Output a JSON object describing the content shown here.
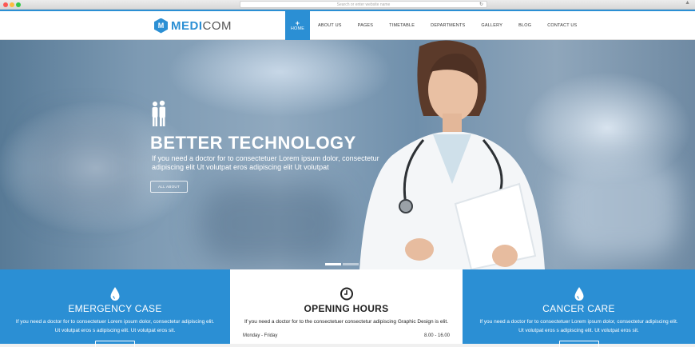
{
  "browser": {
    "url_placeholder": "Search or enter website name",
    "traffic_colors": [
      "#fc5753",
      "#fdbc40",
      "#33c748"
    ]
  },
  "brand": {
    "logo_letter": "M",
    "name_bold": "MEDI",
    "name_light": "COM",
    "accent_color": "#2b8fd4"
  },
  "nav": {
    "items": [
      {
        "label": "HOME",
        "active": true
      },
      {
        "label": "ABOUT US"
      },
      {
        "label": "PAGES"
      },
      {
        "label": "TIMETABLE"
      },
      {
        "label": "DEPARTMENTS"
      },
      {
        "label": "GALLERY"
      },
      {
        "label": "BLOG"
      },
      {
        "label": "CONTACT US"
      }
    ],
    "active_icon": "plus-icon"
  },
  "hero": {
    "icon": "family-icon",
    "title": "BETTER TECHNOLOGY",
    "text": "If you need a doctor for to consectetuer Lorem ipsum dolor, consectetur adipiscing elit  Ut volutpat eros adipiscing elit Ut volutpat",
    "button_label": "ALL ABOUT",
    "slide_count": 2,
    "active_slide": 1
  },
  "panels": [
    {
      "icon": "drop-icon",
      "title": "EMERGENCY CASE",
      "text_line1": "If you need a doctor for to consectetuer Lorem ipsum dolor, consectetur adipiscing elit.",
      "text_line2": "Ut volutpat eros s adipiscing elit. Ut volutpat eros sit."
    },
    {
      "icon": "clock-icon",
      "title": "OPENING HOURS",
      "text_line1": "If you need a doctor for to the consectetuer consectetur adipiscing Graphic Design is elit.",
      "hours": [
        {
          "days": "Monday - Friday",
          "time": "8.00 - 16.00"
        }
      ]
    },
    {
      "icon": "drop-icon",
      "title": "CANCER CARE",
      "text_line1": "If you need a doctor for to consectetuer Lorem ipsum dolor, consectetur adipiscing elit.",
      "text_line2": "Ut volutpat eros s adipiscing elit. Ut volutpat eros sit."
    }
  ]
}
